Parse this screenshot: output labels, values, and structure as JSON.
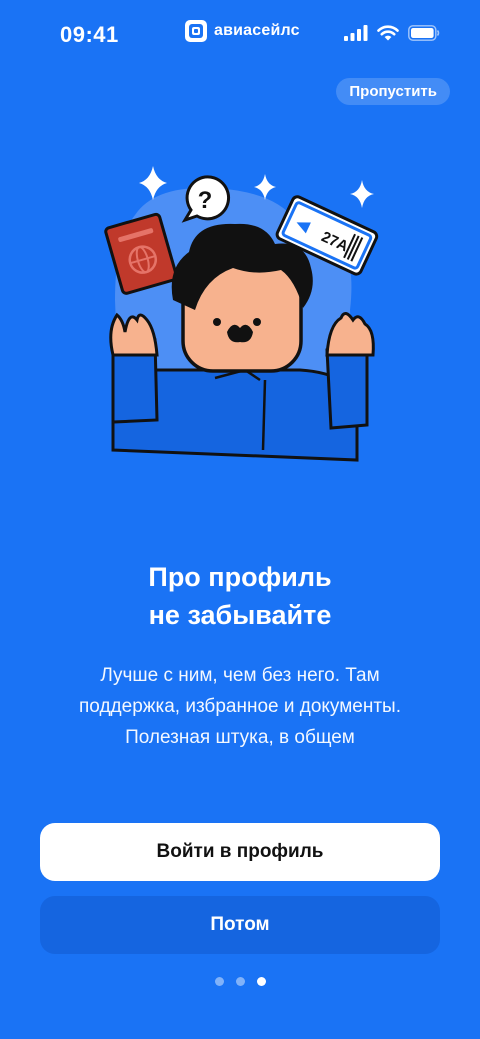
{
  "status_bar": {
    "time": "09:41",
    "icons": [
      "cellular-icon",
      "wifi-icon",
      "battery-icon"
    ]
  },
  "brand": {
    "name": "авиасейлс",
    "icon": "aviasales-logo-icon"
  },
  "skip_label": "Пропустить",
  "illustration": {
    "ticket_seat": "27A",
    "question_mark": "?",
    "icons": [
      "passport-icon",
      "boarding-pass-icon",
      "question-bubble-icon",
      "sparkle-icon"
    ]
  },
  "title": {
    "line1": "Про профиль",
    "line2": "не забывайте"
  },
  "subtitle": {
    "line1": "Лучше с ним, чем без него. Там",
    "line2": "поддержка, избранное и документы.",
    "line3": "Полезная штука, в общем"
  },
  "buttons": {
    "login": "Войти в профиль",
    "later": "Потом"
  },
  "pagination": {
    "total": 3,
    "active": 3
  },
  "colors": {
    "background": "#1a73f5",
    "secondary_button": "#1565e0",
    "passport": "#c0392b",
    "face": "#f7b28e"
  }
}
